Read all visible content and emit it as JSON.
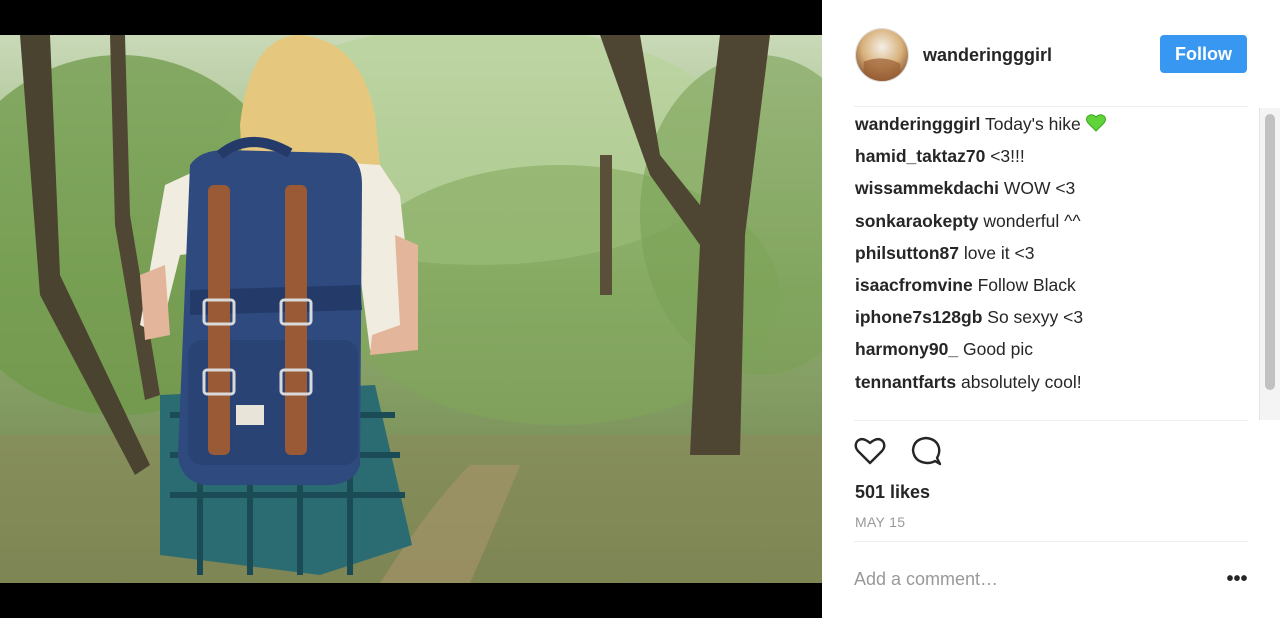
{
  "post": {
    "username": "wanderingggirl",
    "follow_label": "Follow",
    "likes": "501 likes",
    "date": "MAY 15"
  },
  "comments": [
    {
      "author": "wanderingggirl",
      "text": " Today's hike"
    },
    {
      "author": "hamid_taktaz70",
      "text": " <3!!!"
    },
    {
      "author": "wissammekdachi",
      "text": " WOW <3"
    },
    {
      "author": "sonkaraokepty",
      "text": " wonderful ^^"
    },
    {
      "author": "philsutton87",
      "text": " love it <3"
    },
    {
      "author": "isaacfromvine",
      "text": " Follow Black"
    },
    {
      "author": "iphone7s128gb",
      "text": " So sexyy <3"
    },
    {
      "author": "harmony90_",
      "text": " Good pic"
    },
    {
      "author": "tennantfarts",
      "text": " absolutely cool!"
    }
  ],
  "composer": {
    "placeholder": "Add a comment…",
    "more_label": "•••"
  },
  "icons": {
    "like": "heart-icon",
    "comment": "comment-bubble-icon",
    "caption_emoji": "green-heart-emoji"
  },
  "colors": {
    "follow_button": "#3897f0",
    "text_primary": "#262626",
    "text_muted": "#999999",
    "emoji_green": "#5fd33a"
  }
}
